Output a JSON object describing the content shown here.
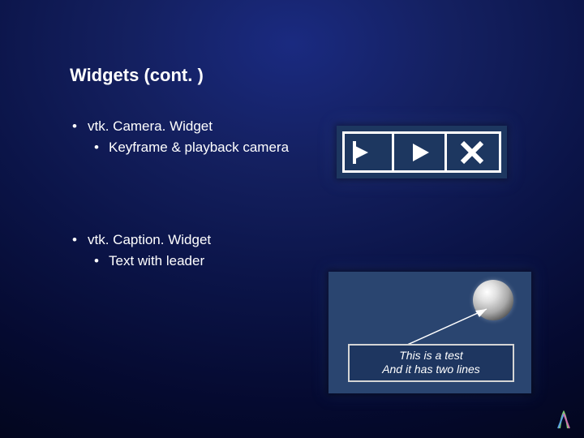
{
  "title": "Widgets (cont. )",
  "items": [
    {
      "label": "vtk. Camera. Widget",
      "sub": "Keyframe & playback camera"
    },
    {
      "label": "vtk. Caption. Widget",
      "sub": "Text with leader"
    }
  ],
  "caption_box": {
    "line1": "This is a test",
    "line2": "And it has two lines"
  },
  "icons": {
    "flag": "flag-icon",
    "play": "play-icon",
    "close": "x-icon"
  }
}
